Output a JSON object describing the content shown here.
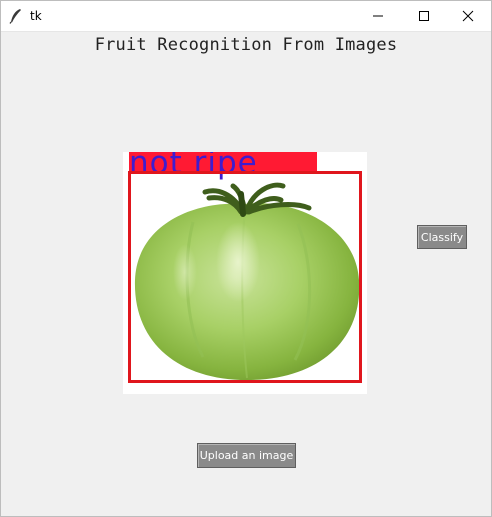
{
  "window": {
    "title": "tk",
    "controls": {
      "minimize": "minimize-icon",
      "maximize": "maximize-icon",
      "close": "close-icon"
    }
  },
  "main": {
    "heading": "Fruit Recognition From Images",
    "detection": {
      "label": "not ripe",
      "label_background_color": "#ff1a33",
      "label_text_color": "#3f1ccf",
      "box_color": "#e0161d",
      "image_subject": "green tomato"
    },
    "classify_button": "Classify",
    "upload_button": "Upload an image"
  },
  "colors": {
    "window_background": "#f0f0f0",
    "button_background": "#8a8a8a",
    "button_text": "#ffffff"
  }
}
